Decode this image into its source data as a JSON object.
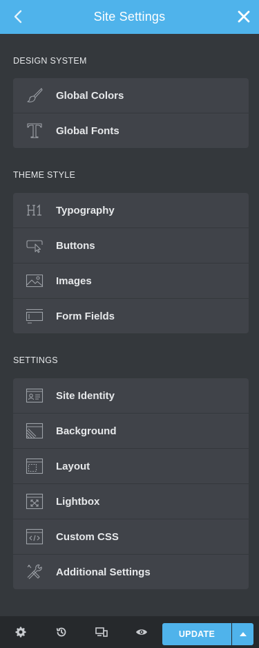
{
  "header": {
    "title": "Site Settings",
    "back_icon": "chevron-left-icon",
    "close_icon": "close-icon"
  },
  "sections": {
    "design_system": {
      "title": "DESIGN SYSTEM",
      "items": [
        {
          "label": "Global Colors",
          "icon": "brush-icon"
        },
        {
          "label": "Global Fonts",
          "icon": "text-t-icon"
        }
      ]
    },
    "theme_style": {
      "title": "THEME STYLE",
      "items": [
        {
          "label": "Typography",
          "icon": "heading-h1-icon"
        },
        {
          "label": "Buttons",
          "icon": "button-pointer-icon"
        },
        {
          "label": "Images",
          "icon": "image-icon"
        },
        {
          "label": "Form Fields",
          "icon": "form-field-icon"
        }
      ]
    },
    "settings": {
      "title": "SETTINGS",
      "items": [
        {
          "label": "Site Identity",
          "icon": "id-card-icon"
        },
        {
          "label": "Background",
          "icon": "background-icon"
        },
        {
          "label": "Layout",
          "icon": "layout-icon"
        },
        {
          "label": "Lightbox",
          "icon": "lightbox-icon"
        },
        {
          "label": "Custom CSS",
          "icon": "code-window-icon"
        },
        {
          "label": "Additional Settings",
          "icon": "tools-icon"
        }
      ]
    }
  },
  "footer": {
    "update_label": "UPDATE",
    "icons": [
      "gear-icon",
      "history-icon",
      "responsive-icon",
      "eye-icon",
      "caret-up-icon"
    ]
  },
  "colors": {
    "accent": "#4fb3eb",
    "panel": "#34383c",
    "card": "#404349",
    "footer": "#26292c"
  }
}
